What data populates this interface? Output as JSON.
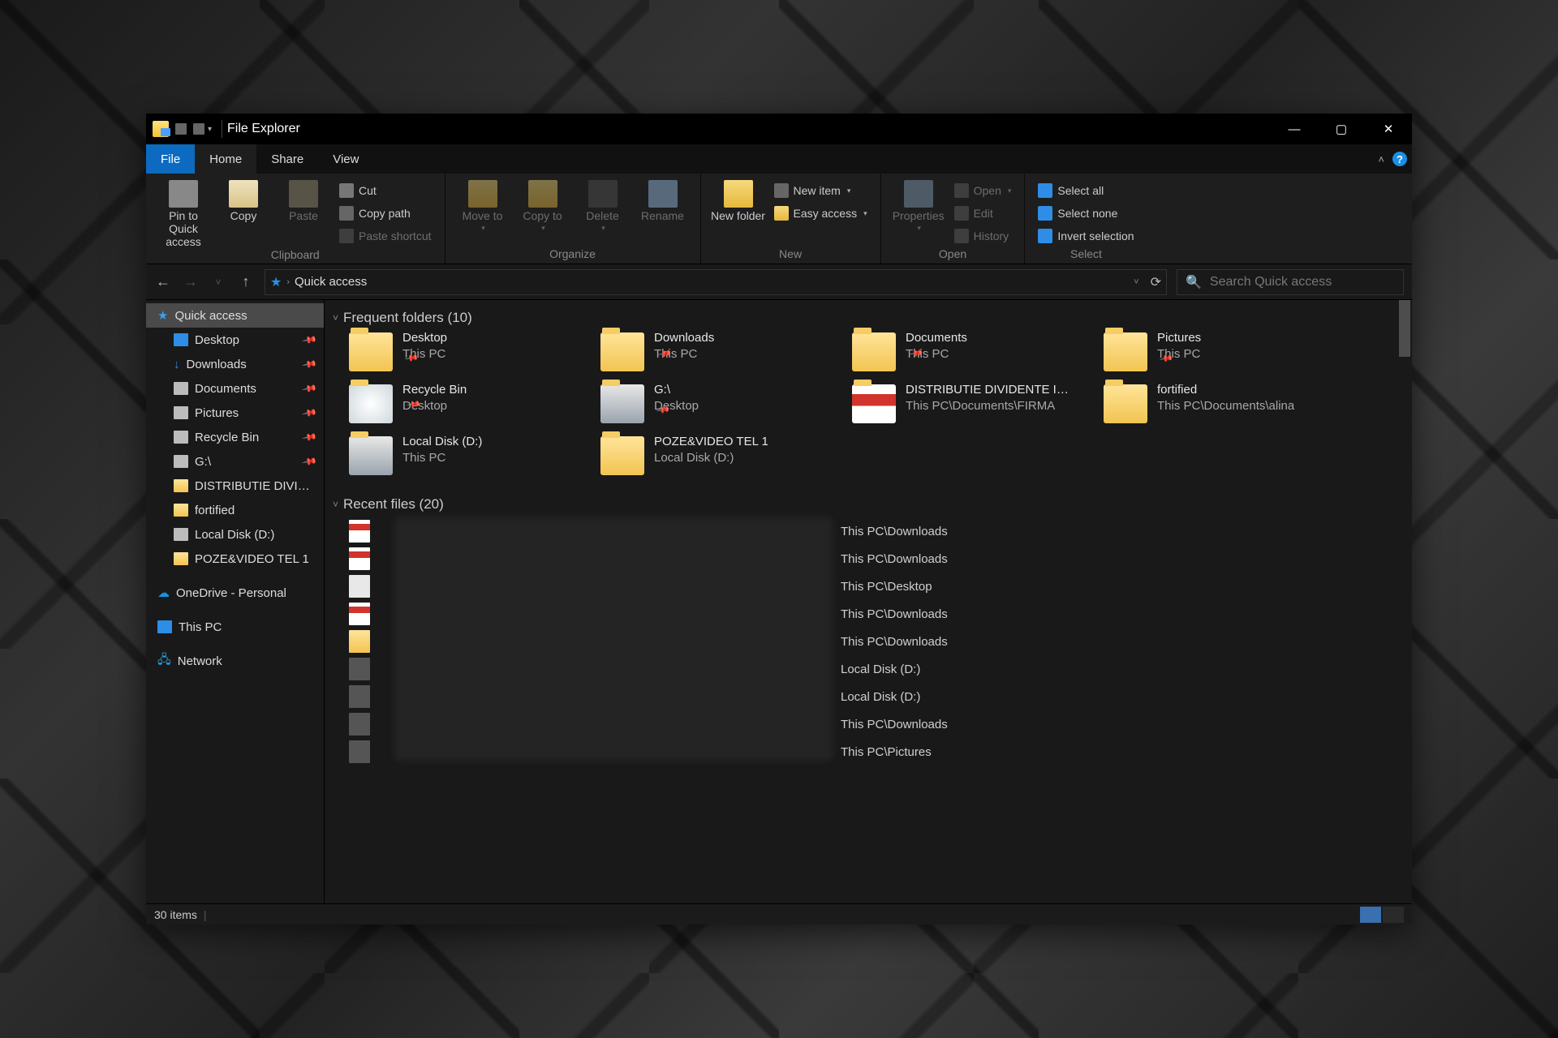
{
  "title": "File Explorer",
  "tabs": {
    "file": "File",
    "home": "Home",
    "share": "Share",
    "view": "View"
  },
  "ribbon": {
    "clipboard": {
      "label": "Clipboard",
      "pin": "Pin to Quick access",
      "copy": "Copy",
      "paste": "Paste",
      "cut": "Cut",
      "copypath": "Copy path",
      "shortcut": "Paste shortcut"
    },
    "organize": {
      "label": "Organize",
      "moveto": "Move to",
      "copyto": "Copy to",
      "delete": "Delete",
      "rename": "Rename"
    },
    "new": {
      "label": "New",
      "newfolder": "New folder",
      "newitem": "New item",
      "easy": "Easy access"
    },
    "open": {
      "label": "Open",
      "properties": "Properties",
      "open": "Open",
      "edit": "Edit",
      "history": "History"
    },
    "select": {
      "label": "Select",
      "all": "Select all",
      "none": "Select none",
      "invert": "Invert selection"
    }
  },
  "address": {
    "location": "Quick access"
  },
  "search": {
    "placeholder": "Search Quick access"
  },
  "sidebar": {
    "quick": "Quick access",
    "items": [
      {
        "label": "Desktop",
        "pin": true,
        "icon": "sbi-desktop"
      },
      {
        "label": "Downloads",
        "pin": true,
        "icon": "sbi-down"
      },
      {
        "label": "Documents",
        "pin": true,
        "icon": "sbi-doc"
      },
      {
        "label": "Pictures",
        "pin": true,
        "icon": "sbi-pic"
      },
      {
        "label": "Recycle Bin",
        "pin": true,
        "icon": "sbi-bin"
      },
      {
        "label": "G:\\",
        "pin": true,
        "icon": "sbi-drive"
      },
      {
        "label": "DISTRIBUTIE DIVIDENTE",
        "pin": false,
        "icon": "sbi-folder"
      },
      {
        "label": "fortified",
        "pin": false,
        "icon": "sbi-folder"
      },
      {
        "label": "Local Disk (D:)",
        "pin": false,
        "icon": "sbi-drive"
      },
      {
        "label": "POZE&VIDEO TEL 1",
        "pin": false,
        "icon": "sbi-folder"
      }
    ],
    "onedrive": "OneDrive - Personal",
    "thispc": "This PC",
    "network": "Network"
  },
  "sections": {
    "frequent": "Frequent folders (10)",
    "recent": "Recent files (20)"
  },
  "folders": [
    {
      "name": "Desktop",
      "loc": "This PC",
      "pin": true,
      "icon": "desktop"
    },
    {
      "name": "Downloads",
      "loc": "This PC",
      "pin": true,
      "icon": "down"
    },
    {
      "name": "Documents",
      "loc": "This PC",
      "pin": true,
      "icon": "doc"
    },
    {
      "name": "Pictures",
      "loc": "This PC",
      "pin": true,
      "icon": "pic"
    },
    {
      "name": "Recycle Bin",
      "loc": "Desktop",
      "pin": true,
      "icon": "bin"
    },
    {
      "name": "G:\\",
      "loc": "Desktop",
      "pin": true,
      "icon": "drive"
    },
    {
      "name": "DISTRIBUTIE DIVIDENTE IU…",
      "loc": "This PC\\Documents\\FIRMA",
      "pin": false,
      "icon": "pdf"
    },
    {
      "name": "fortified",
      "loc": "This PC\\Documents\\alina",
      "pin": false,
      "icon": "folder"
    },
    {
      "name": "Local Disk (D:)",
      "loc": "This PC",
      "pin": false,
      "icon": "hdd"
    },
    {
      "name": "POZE&VIDEO TEL 1",
      "loc": "Local Disk (D:)",
      "pin": false,
      "icon": "folder"
    }
  ],
  "recent": [
    {
      "loc": "This PC\\Downloads",
      "thumb": "pdf"
    },
    {
      "loc": "This PC\\Downloads",
      "thumb": "pdf"
    },
    {
      "loc": "This PC\\Desktop",
      "thumb": "paper"
    },
    {
      "loc": "This PC\\Downloads",
      "thumb": "pdf"
    },
    {
      "loc": "This PC\\Downloads",
      "thumb": "zip"
    },
    {
      "loc": "Local Disk (D:)",
      "thumb": "img"
    },
    {
      "loc": "Local Disk (D:)",
      "thumb": "img"
    },
    {
      "loc": "This PC\\Downloads",
      "thumb": "img"
    },
    {
      "loc": "This PC\\Pictures",
      "thumb": "img"
    }
  ],
  "status": {
    "count": "30 items"
  }
}
